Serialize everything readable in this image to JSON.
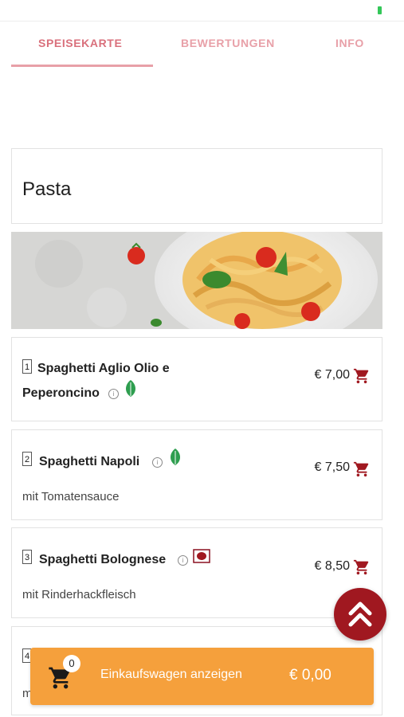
{
  "tabs": [
    {
      "label": "SPEISEKARTE",
      "active": true
    },
    {
      "label": "BEWERTUNGEN",
      "active": false
    },
    {
      "label": "INFO",
      "active": false
    }
  ],
  "category": {
    "title": "Pasta"
  },
  "items": [
    {
      "number": "1",
      "name_line1": "Spaghetti Aglio Olio e",
      "name_line2": "Peperoncino",
      "description": "",
      "price": "€ 7,00",
      "badge": "leaf-icon"
    },
    {
      "number": "2",
      "name_line1": "Spaghetti Napoli",
      "description": "mit Tomatensauce",
      "price": "€ 7,50",
      "badge": "leaf-icon"
    },
    {
      "number": "3",
      "name_line1": "Spaghetti Bolognese",
      "description": "mit Rinderhackfleisch",
      "price": "€ 8,50",
      "badge": "beef-icon"
    },
    {
      "number": "4",
      "name_line1": "",
      "description": "m",
      "price": "",
      "badge": ""
    }
  ],
  "cart": {
    "count": "0",
    "label": "Einkaufswagen anzeigen",
    "total": "€ 0,00"
  },
  "colors": {
    "accent": "#d9707c",
    "cart_bar": "#f5a03c",
    "dark_red": "#a01820",
    "leaf": "#2e9e4f"
  }
}
